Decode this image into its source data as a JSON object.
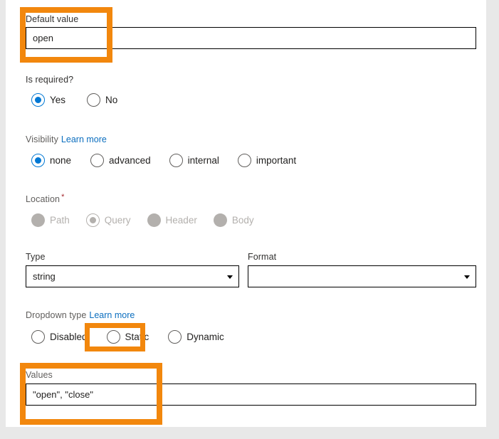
{
  "form": {
    "default_value": {
      "label": "Default value",
      "value": "open",
      "placeholder": ""
    },
    "is_required": {
      "label": "Is required?",
      "options": [
        {
          "label": "Yes",
          "selected": true
        },
        {
          "label": "No",
          "selected": false
        }
      ]
    },
    "visibility": {
      "label": "Visibility",
      "learn_more": "Learn more",
      "options": [
        {
          "label": "none",
          "selected": true
        },
        {
          "label": "advanced",
          "selected": false
        },
        {
          "label": "internal",
          "selected": false
        },
        {
          "label": "important",
          "selected": false
        }
      ]
    },
    "location": {
      "label": "Location",
      "required_marker": "*",
      "disabled": true,
      "options": [
        {
          "label": "Path",
          "selected": false
        },
        {
          "label": "Query",
          "selected": true
        },
        {
          "label": "Header",
          "selected": false
        },
        {
          "label": "Body",
          "selected": false
        }
      ]
    },
    "type": {
      "label": "Type",
      "value": "string"
    },
    "format": {
      "label": "Format",
      "value": ""
    },
    "dropdown_type": {
      "label": "Dropdown type",
      "learn_more": "Learn more",
      "options": [
        {
          "label": "Disabled",
          "selected": false
        },
        {
          "label": "Static",
          "selected": true
        },
        {
          "label": "Dynamic",
          "selected": false
        }
      ]
    },
    "values": {
      "label": "Values",
      "value": "\"open\", \"close\"",
      "placeholder": ""
    }
  },
  "annotations": {
    "highlight_color": "#f2870d",
    "boxes": [
      {
        "name": "default-value-highlight"
      },
      {
        "name": "static-option-highlight"
      },
      {
        "name": "values-highlight"
      }
    ]
  },
  "colors": {
    "accent": "#0078d4",
    "link": "#0b6ebf",
    "required": "#a4262c",
    "disabled": "#b3b0ad",
    "page_background": "#e8e8e8",
    "panel_background": "#ffffff"
  }
}
